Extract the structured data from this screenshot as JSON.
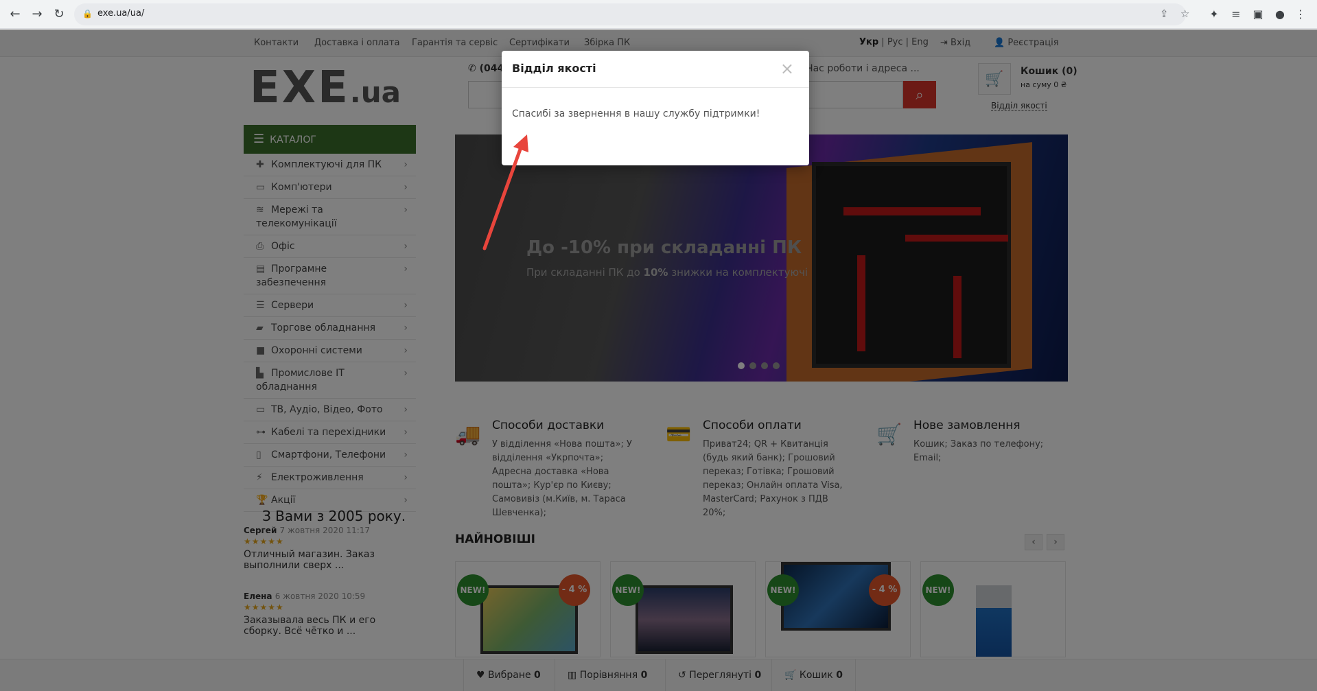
{
  "browser": {
    "url": "exe.ua/ua/"
  },
  "topbar": {
    "links": [
      "Контакти",
      "Доставка і оплата",
      "Гарантія та сервіс",
      "Сертифікати",
      "Збірка ПК"
    ],
    "lang_ukr": "Укр",
    "lang_rus": "Рус",
    "lang_eng": "Eng",
    "login": "Вхід",
    "register": "Реєстрація"
  },
  "header": {
    "logo_main": "EXE",
    "logo_ua": ".ua",
    "phone": "(044",
    "hours": "Час роботи і адреса ...",
    "cart_title": "Кошик (0)",
    "cart_sum": "на суму 0 ₴",
    "quality_link": "Відділ якості"
  },
  "sidebar": {
    "catalog_label": "КАТАЛОГ",
    "items": [
      {
        "label": "Комплектуючі для ПК",
        "icon": "puzzle-icon"
      },
      {
        "label": "Комп'ютери",
        "icon": "laptop-icon"
      },
      {
        "label": "Мережі та телекомунікації",
        "icon": "wifi-icon"
      },
      {
        "label": "Офіс",
        "icon": "printer-icon"
      },
      {
        "label": "Програмне забезпечення",
        "icon": "document-icon"
      },
      {
        "label": "Сервери",
        "icon": "server-icon"
      },
      {
        "label": "Торгове обладнання",
        "icon": "shopping-bag-icon"
      },
      {
        "label": "Охоронні системи",
        "icon": "camera-icon"
      },
      {
        "label": "Промислове IT обладнання",
        "icon": "factory-icon"
      },
      {
        "label": "ТВ, Аудіо, Відео, Фото",
        "icon": "monitor-icon"
      },
      {
        "label": "Кабелі та перехідники",
        "icon": "cable-icon"
      },
      {
        "label": "Смартфони, Телефони",
        "icon": "phone-icon"
      },
      {
        "label": "Електроживлення",
        "icon": "plug-icon"
      },
      {
        "label": "Акції",
        "icon": "trophy-icon"
      }
    ],
    "since": "З Вами з 2005 року.",
    "reviews": [
      {
        "author": "Сергей",
        "date": "7 жовтня 2020 11:17",
        "text": "Отличный магазин. Заказ выполнили сверх ..."
      },
      {
        "author": "Елена",
        "date": "6 жовтня 2020 10:59",
        "text": "Заказывала весь ПК и его сборку. Всё чётко и ..."
      }
    ]
  },
  "banner": {
    "title": "До -10% при складанні ПК",
    "sub_prefix": "При складанні ПК до ",
    "sub_bold": "10%",
    "sub_suffix": " знижки на комплектуючі"
  },
  "info": [
    {
      "title": "Способи доставки",
      "text": "У відділення «Нова пошта»;  У відділення «Укрпочта»;  Адресна доставка «Нова пошта»;  Кур'єр по Києву;  Самовивіз (м.Київ, м. Тараса Шевченка);"
    },
    {
      "title": "Способи оплати",
      "text": "Приват24;  QR + Квитанція (будь який банк);  Грошовий переказ; Готівка;  Грошовий переказ; Онлайн оплата Visa, MasterCard; Рахунок з ПДВ 20%;"
    },
    {
      "title": "Нове замовлення",
      "text": "Кошик; Заказ по телефону; Email;"
    }
  ],
  "newest": {
    "heading": "НАЙНОВІШІ",
    "badge_new": "NEW!",
    "discount": "- 4 %"
  },
  "bottom": {
    "fav": "Вибране",
    "fav_count": "0",
    "compare": "Порівняння",
    "compare_count": "0",
    "viewed": "Переглянуті",
    "viewed_count": "0",
    "cart": "Кошик",
    "cart_count": "0"
  },
  "modal": {
    "title": "Відділ якості",
    "close": "×",
    "message": "Спасибі за звернення в нашу службу підтримки!"
  }
}
